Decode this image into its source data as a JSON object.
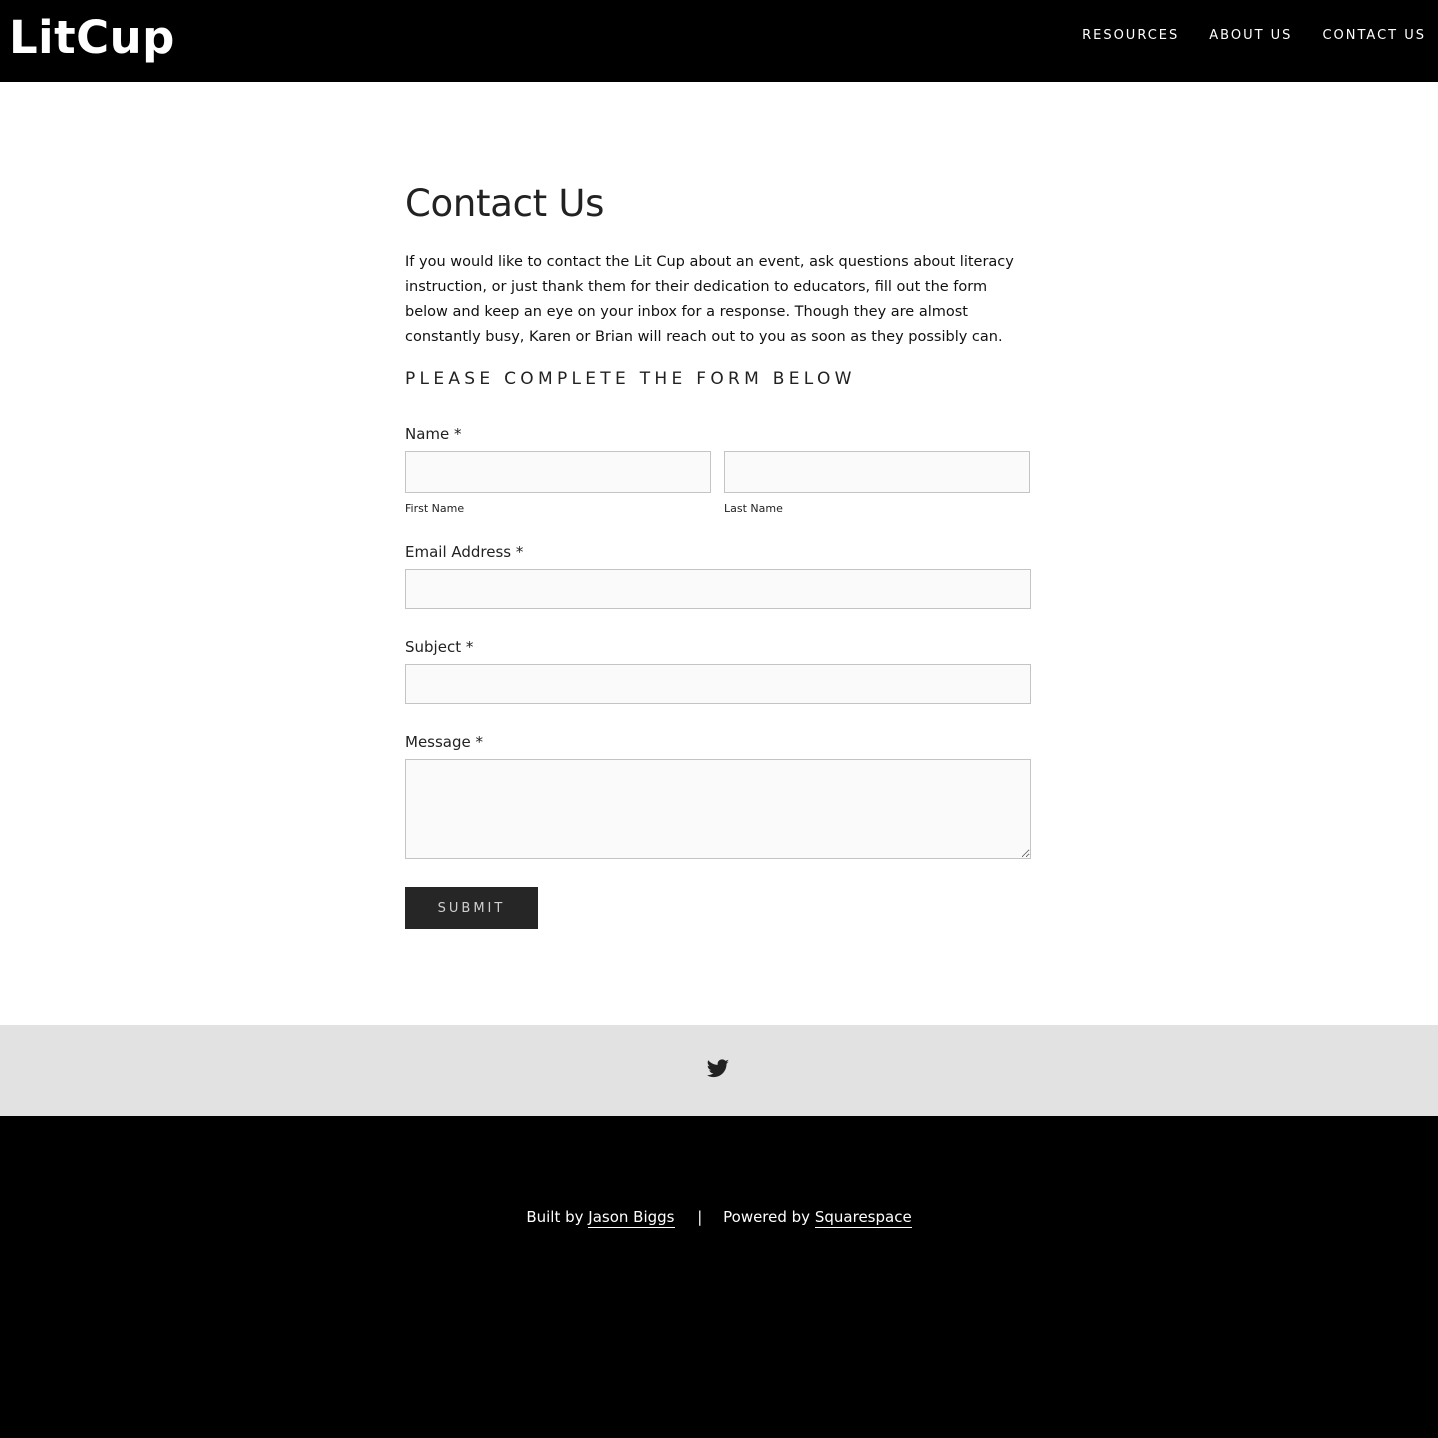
{
  "header": {
    "logo": "LitCup",
    "nav": [
      {
        "label": "RESOURCES"
      },
      {
        "label": "ABOUT US"
      },
      {
        "label": "CONTACT US"
      }
    ]
  },
  "main": {
    "title": "Contact Us",
    "intro": "If you would like to contact the Lit Cup about an event, ask questions about literacy instruction, or just thank them for their dedication to educators, fill out the form below and keep an eye on your inbox for a response. Though they are almost constantly busy, Karen or Brian will reach out to you as soon as they possibly can.",
    "form_heading": "PLEASE COMPLETE THE FORM BELOW"
  },
  "form": {
    "name_label": "Name *",
    "first_name_sublabel": "First Name",
    "first_name_value": "",
    "last_name_sublabel": "Last Name",
    "last_name_value": "",
    "email_label": "Email Address *",
    "email_value": "",
    "subject_label": "Subject *",
    "subject_value": "",
    "message_label": "Message *",
    "message_value": "",
    "submit_label": "SUBMIT"
  },
  "social": {
    "icons": [
      "twitter-icon"
    ]
  },
  "footer": {
    "built_by_prefix": "Built by",
    "built_by_link": "Jason Biggs",
    "separator": "|",
    "powered_by_prefix": "Powered by",
    "powered_by_link": "Squarespace"
  },
  "colors": {
    "header_bg": "#000000",
    "social_bar_bg": "#e2e2e2",
    "footer_bg": "#000000",
    "button_bg": "#262626"
  }
}
